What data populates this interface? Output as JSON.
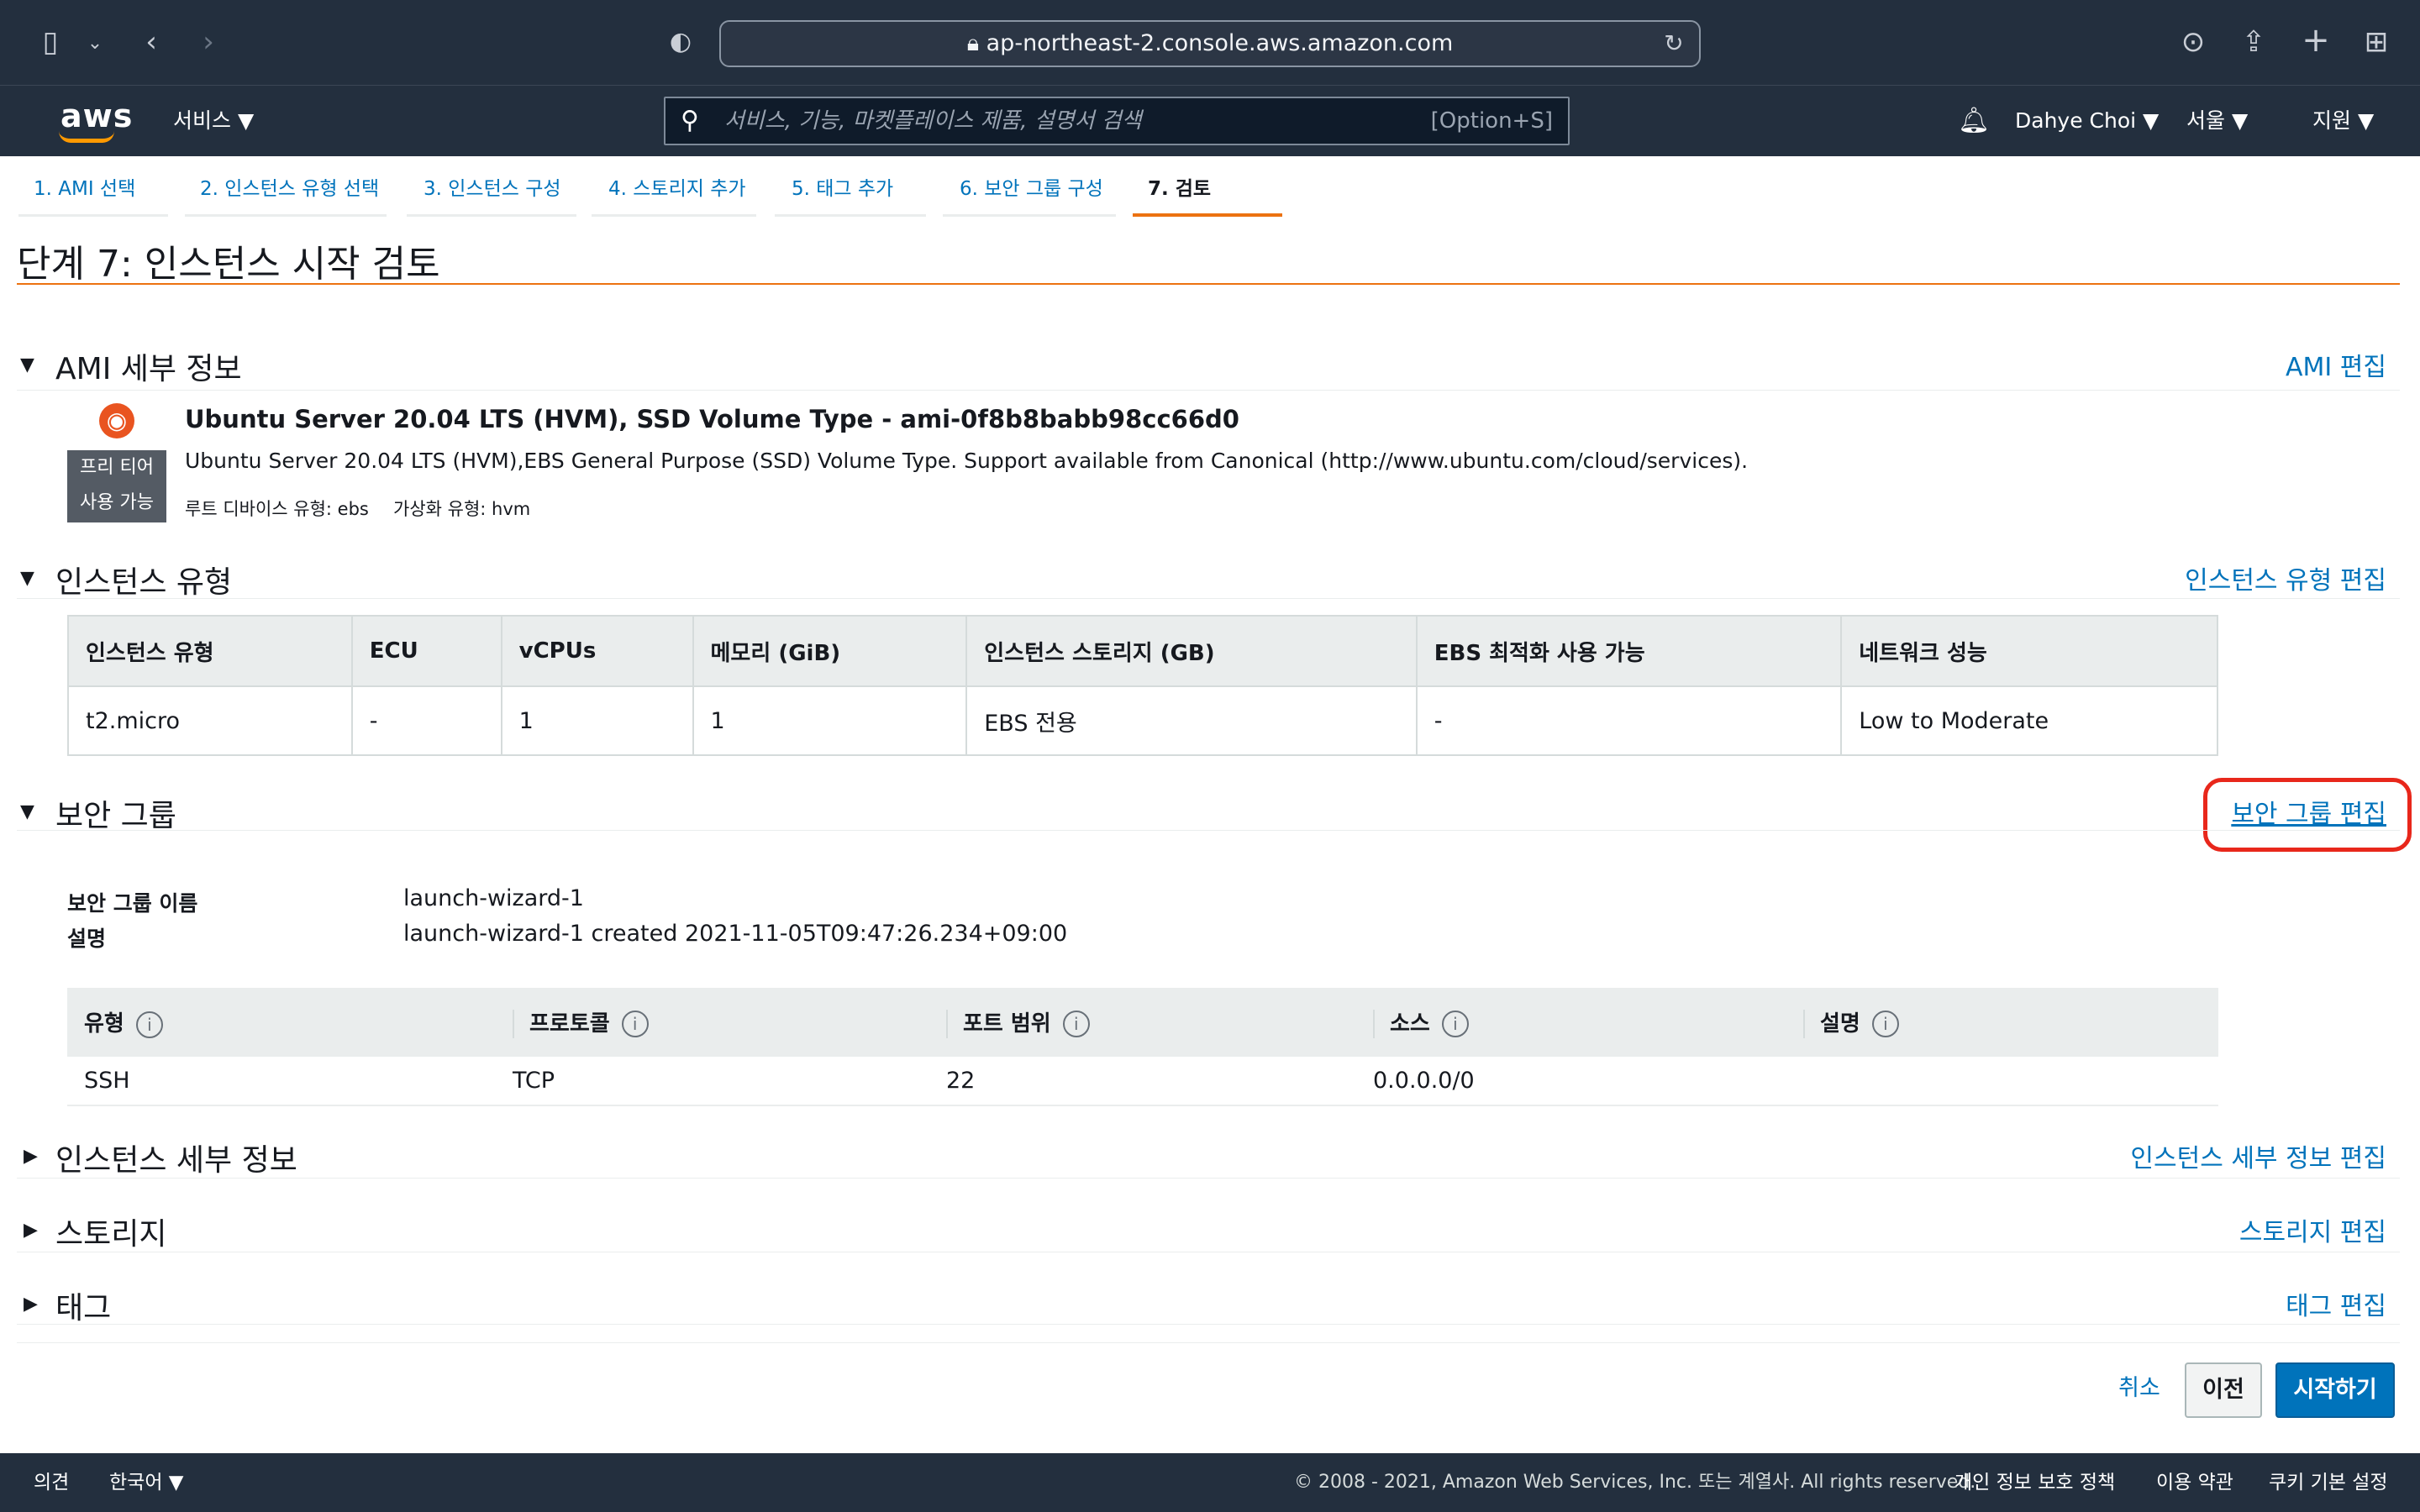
{
  "browser": {
    "url": "ap-northeast-2.console.aws.amazon.com",
    "lock_icon": "lock-icon",
    "icons": [
      "sidebar-icon",
      "chevron-down-icon",
      "back-icon",
      "forward-icon",
      "shield-icon",
      "reload-icon",
      "download-icon",
      "share-icon",
      "new-tab-icon",
      "tab-overview-icon"
    ]
  },
  "nav": {
    "logo": "aws",
    "services": "서비스",
    "search_placeholder": "서비스, 기능, 마켓플레이스 제품, 설명서 검색",
    "search_shortcut": "[Option+S]",
    "user": "Dahye Choi",
    "region": "서울",
    "support": "지원"
  },
  "wizard": {
    "tabs": [
      {
        "label": "1. AMI 선택"
      },
      {
        "label": "2. 인스턴스 유형 선택"
      },
      {
        "label": "3. 인스턴스 구성"
      },
      {
        "label": "4. 스토리지 추가"
      },
      {
        "label": "5. 태그 추가"
      },
      {
        "label": "6. 보안 그룹 구성"
      },
      {
        "label": "7. 검토"
      }
    ],
    "active_index": 6
  },
  "page_title": "단계 7: 인스턴스 시작 검토",
  "ami": {
    "section_title": "AMI 세부 정보",
    "edit": "AMI 편집",
    "free_tier": "프리 티어 사용 가능",
    "name": "Ubuntu Server 20.04 LTS (HVM), SSD Volume Type - ami-0f8b8babb98cc66d0",
    "description": "Ubuntu Server 20.04 LTS (HVM),EBS General Purpose (SSD) Volume Type. Support available from Canonical (http://www.ubuntu.com/cloud/services).",
    "root_device": "루트 디바이스 유형: ebs",
    "virtualization": "가상화 유형: hvm"
  },
  "instance_type": {
    "section_title": "인스턴스 유형",
    "edit": "인스턴스 유형 편집",
    "headers": [
      "인스턴스 유형",
      "ECU",
      "vCPUs",
      "메모리 (GiB)",
      "인스턴스 스토리지 (GB)",
      "EBS 최적화 사용 가능",
      "네트워크 성능"
    ],
    "row": [
      "t2.micro",
      "-",
      "1",
      "1",
      "EBS 전용",
      "-",
      "Low to Moderate"
    ]
  },
  "security_group": {
    "section_title": "보안 그룹",
    "edit": "보안 그룹 편집",
    "name_label": "보안 그룹 이름",
    "name_value": "launch-wizard-1",
    "desc_label": "설명",
    "desc_value": "launch-wizard-1 created 2021-11-05T09:47:26.234+09:00",
    "headers": [
      "유형",
      "프로토콜",
      "포트 범위",
      "소스",
      "설명"
    ],
    "rows": [
      [
        "SSH",
        "TCP",
        "22",
        "0.0.0.0/0",
        ""
      ]
    ]
  },
  "instance_details": {
    "section_title": "인스턴스 세부 정보",
    "edit": "인스턴스 세부 정보 편집"
  },
  "storage": {
    "section_title": "스토리지",
    "edit": "스토리지 편집"
  },
  "tags": {
    "section_title": "태그",
    "edit": "태그 편집"
  },
  "actions": {
    "cancel": "취소",
    "previous": "이전",
    "launch": "시작하기"
  },
  "footer": {
    "feedback": "의견",
    "language": "한국어",
    "copyright": "© 2008 - 2021, Amazon Web Services, Inc. 또는 계열사. All rights reserved.",
    "privacy": "개인 정보 보호 정책",
    "terms": "이용 약관",
    "cookies": "쿠키 기본 설정"
  },
  "colors": {
    "accent": "#ec7211",
    "link": "#0073bb",
    "nav_bg": "#232f3e",
    "highlight": "#e8271b"
  }
}
